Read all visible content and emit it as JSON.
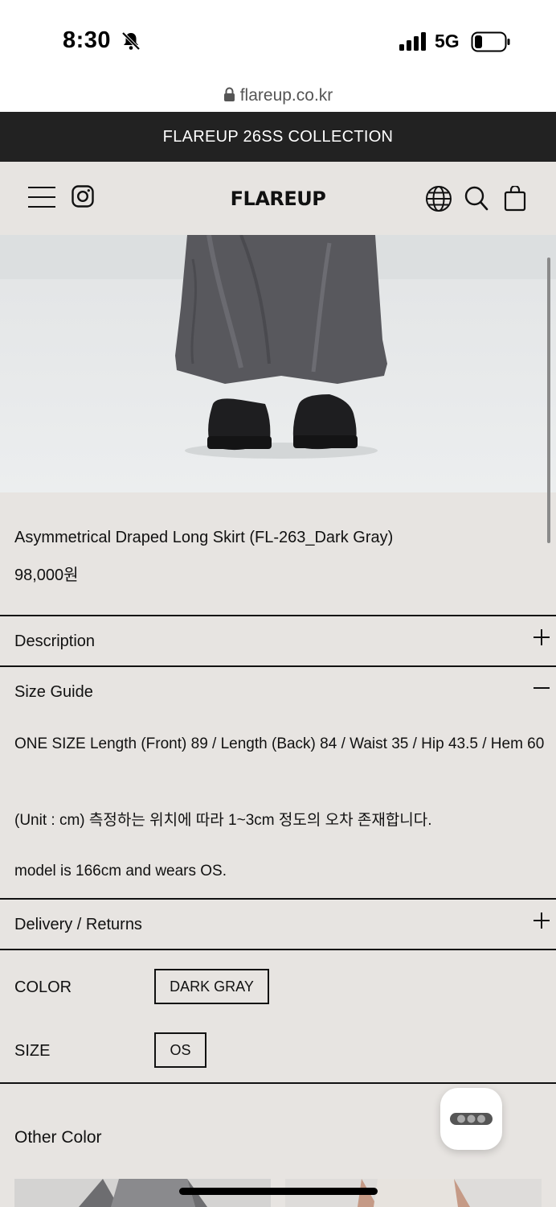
{
  "status_bar": {
    "time": "8:30",
    "network": "5G",
    "icons": [
      "bell-slash-icon",
      "signal-icon",
      "battery-icon"
    ]
  },
  "browser": {
    "url": "flareup.co.kr"
  },
  "announcement": "FLAREUP 26SS COLLECTION",
  "header": {
    "logo": "FLAREUP",
    "icons": [
      "menu-icon",
      "instagram-icon",
      "globe-icon",
      "search-icon",
      "bag-icon"
    ]
  },
  "product": {
    "title": "Asymmetrical Draped Long Skirt (FL-263_Dark Gray)",
    "price": "98,000원"
  },
  "accordions": {
    "description": {
      "label": "Description",
      "state": "collapsed"
    },
    "size_guide": {
      "label": "Size Guide",
      "state": "expanded",
      "line1": "ONE SIZE Length (Front) 89 / Length (Back) 84 / Waist 35 / Hip 43.5 / Hem 60",
      "line2": "(Unit : cm) 측정하는 위치에 따라 1~3cm 정도의 오차 존재합니다.",
      "line3": "model is 166cm and wears OS."
    },
    "delivery": {
      "label": "Delivery / Returns",
      "state": "collapsed"
    }
  },
  "options": {
    "color_label": "COLOR",
    "color_value": "DARK GRAY",
    "size_label": "SIZE",
    "size_value": "OS"
  },
  "other_color": {
    "heading": "Other Color"
  },
  "colors": {
    "announce_bg": "#222222",
    "page_bg": "#e7e4e1",
    "text": "#111111"
  }
}
